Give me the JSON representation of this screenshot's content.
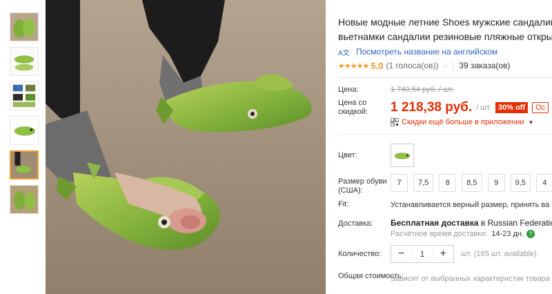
{
  "product": {
    "title_line1": "Новые модные летние Shoes мужские сандалии",
    "title_line2": "вьетнамки сандалии резиновые пляжные открытые",
    "translate_link": "Посмотреть название на английском",
    "rating_stars": "★★★★★",
    "rating_value": "5.0",
    "rating_count": "(1 голоса(ов))",
    "orders": "39 заказа(ов)"
  },
  "price": {
    "label_price": "Цена:",
    "old_price": "1 740,54 руб. / шт.",
    "label_discount": "Цена со скидкой:",
    "new_price": "1 218,38 руб.",
    "per_unit": "/ шт.",
    "discount_badge": "30% off",
    "coupon_badge": "Ос",
    "app_discount": "Скидки ещё больше в приложении"
  },
  "options": {
    "color_label": "Цвет:",
    "size_label": "Размер обуви (США):",
    "sizes": [
      "7",
      "7,5",
      "8",
      "8,5",
      "9",
      "9,5",
      "4"
    ],
    "fit_label": "Fit:",
    "fit_value": "Устанавливается верный размер, принять ва"
  },
  "shipping": {
    "label": "Доставка:",
    "free": "Бесплатная доставка",
    "to": "в Russian Federation",
    "est_label": "Расчётное время доставки:",
    "est_value": "14-23 дн."
  },
  "quantity": {
    "label": "Количество:",
    "minus": "−",
    "value": "1",
    "plus": "+",
    "available": "шт. (165 шт. available)"
  },
  "total": {
    "label": "Общая стоимость:",
    "value": "Зависит от выбранных характеристик товара"
  },
  "colors": {
    "accent": "#e62e04",
    "link": "#2e64bd",
    "star": "#f39a26",
    "active_thumb": "#f39a26"
  }
}
